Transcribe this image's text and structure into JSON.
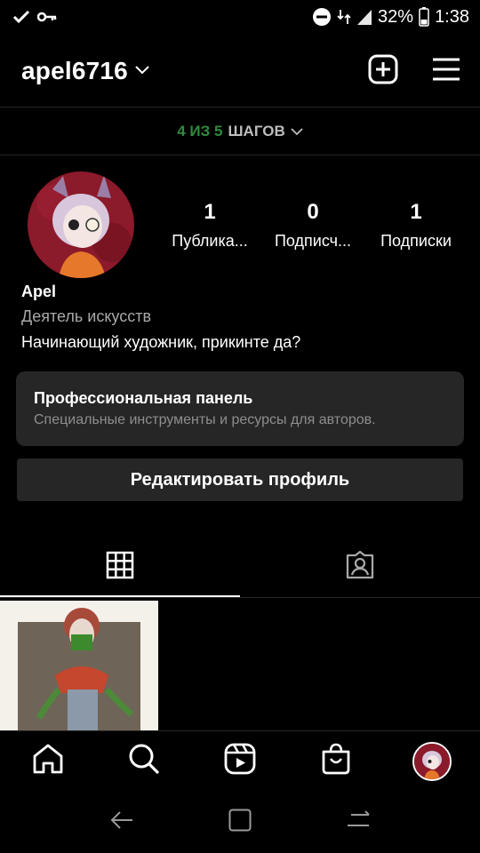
{
  "status_bar": {
    "battery_percent": "32%",
    "time": "1:38",
    "left_icons": [
      "check-icon",
      "key-icon"
    ],
    "right_icons": [
      "do-not-disturb-icon",
      "network-icon",
      "signal-icon",
      "battery-icon"
    ]
  },
  "header": {
    "username": "apel6716",
    "icons": [
      "chevron-down-icon",
      "create-post-icon",
      "menu-icon"
    ]
  },
  "steps": {
    "progress": "4 ИЗ 5",
    "label": "ШАГОВ"
  },
  "profile": {
    "stats": [
      {
        "value": "1",
        "label": "Публика..."
      },
      {
        "value": "0",
        "label": "Подписч..."
      },
      {
        "value": "1",
        "label": "Подписки"
      }
    ],
    "name": "Apel",
    "category": "Деятель искусств",
    "bio": "Начинающий художник, прикинте да?"
  },
  "pro_panel": {
    "title": "Профессиональная панель",
    "subtitle": "Специальные инструменты и ресурсы для авторов."
  },
  "edit_profile_label": "Редактировать профиль",
  "tabs": [
    {
      "icon": "grid-icon",
      "active": true
    },
    {
      "icon": "tagged-icon",
      "active": false
    }
  ],
  "bottom_nav": [
    "home-icon",
    "search-icon",
    "reels-icon",
    "shop-icon",
    "profile-avatar"
  ],
  "system_nav": [
    "back-icon",
    "home-button-icon",
    "recents-icon"
  ],
  "colors": {
    "background": "#000000",
    "panel": "#262626",
    "steps_green": "#2e8b3e",
    "muted_text": "#a8a8a8"
  }
}
